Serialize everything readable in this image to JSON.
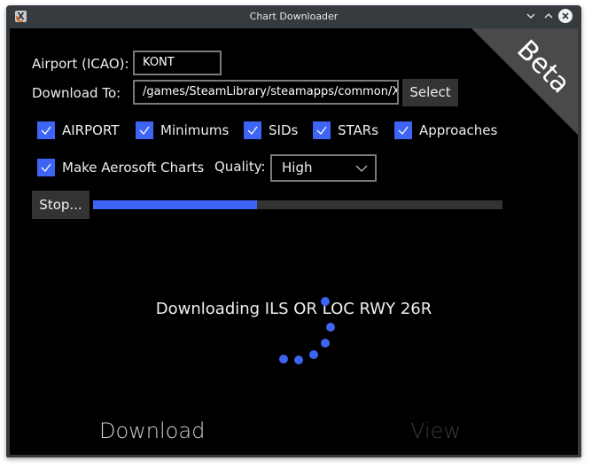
{
  "window": {
    "title": "Chart Downloader",
    "app_icon": "x-app-icon",
    "controls": [
      "minimize",
      "maximize",
      "close"
    ]
  },
  "badge": {
    "text": "Beta"
  },
  "form": {
    "airport_label": "Airport (ICAO):",
    "airport_value": "KONT",
    "download_label": "Download To:",
    "download_value": "/games/SteamLibrary/steamapps/common/X-Pl",
    "select_button": "Select"
  },
  "checkboxes": [
    {
      "label": "AIRPORT",
      "checked": true
    },
    {
      "label": "Minimums",
      "checked": true
    },
    {
      "label": "SIDs",
      "checked": true
    },
    {
      "label": "STARs",
      "checked": true
    },
    {
      "label": "Approaches",
      "checked": true
    }
  ],
  "aerosoft": {
    "label": "Make Aerosoft Charts",
    "checked": true
  },
  "quality": {
    "label": "Quality:",
    "selected": "High"
  },
  "stop_button": "Stop...",
  "progress": {
    "percent": 40
  },
  "status_text": "Downloading ILS OR LOC RWY 26R",
  "tabs": [
    {
      "label": "Download",
      "active": true
    },
    {
      "label": "View",
      "active": false
    }
  ],
  "colors": {
    "accent": "#3d64f5",
    "background": "#000000",
    "button": "#333333",
    "frame": "#353a3f"
  }
}
